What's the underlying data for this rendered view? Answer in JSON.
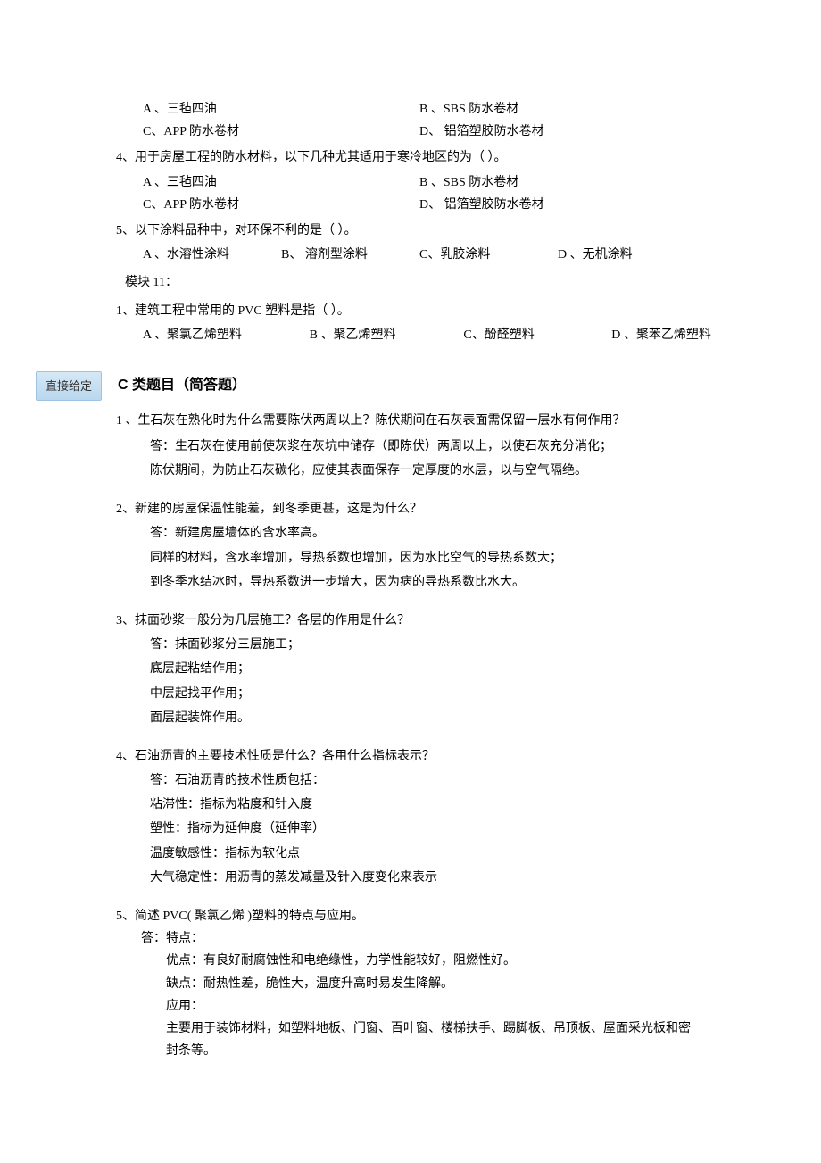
{
  "top": {
    "opts1": {
      "a": "A 、三毡四油",
      "b": "B 、SBS 防水卷材",
      "c": "C、APP 防水卷材",
      "d": "D、 铝箔塑胶防水卷材"
    },
    "q4": "4、用于房屋工程的防水材料，以下几种尤其适用于寒冷地区的为（           ）。",
    "opts4": {
      "a": "A 、三毡四油",
      "b": "B 、SBS 防水卷材",
      "c": "C、APP 防水卷材",
      "d": "D、 铝箔塑胶防水卷材"
    },
    "q5": "5、以下涂料品种中，对环保不利的是（          ）。",
    "opts5": {
      "a": "A 、水溶性涂料",
      "b": "B、 溶剂型涂料",
      "c": "C、乳胶涂料",
      "d": "D 、无机涂料"
    },
    "module": "模块  11：",
    "m11q1": "1、建筑工程中常用的    PVC 塑料是指（       ）。",
    "m11opts": {
      "a": "A 、聚氯乙烯塑料",
      "b": "B 、聚乙烯塑料",
      "c": "C、酚醛塑料",
      "d": "D 、聚苯乙烯塑料"
    }
  },
  "badge": "直接给定",
  "sectionC": "C 类题目（简答题）",
  "c1": {
    "q": "1 、生石灰在熟化时为什么需要陈伏两周以上？陈伏期间在石灰表面需保留一层水有何作用？",
    "a1": "答：生石灰在使用前使灰浆在灰坑中储存（即陈伏）两周以上，以使石灰充分消化；",
    "a2": "陈伏期间，为防止石灰碳化，应使其表面保存一定厚度的水层，以与空气隔绝。"
  },
  "c2": {
    "q": "2、新建的房屋保温性能差，到冬季更甚，这是为什么？",
    "a1": "答：新建房屋墙体的含水率高。",
    "a2": "同样的材料，含水率增加，导热系数也增加，因为水比空气的导热系数大；",
    "a3": "到冬季水结冰时，导热系数进一步增大，因为病的导热系数比水大。"
  },
  "c3": {
    "q": "3、抹面砂浆一般分为几层施工？各层的作用是什么？",
    "a1": "答：抹面砂浆分三层施工；",
    "a2": "底层起粘结作用；",
    "a3": "中层起找平作用；",
    "a4": "面层起装饰作用。"
  },
  "c4": {
    "q": "4、石油沥青的主要技术性质是什么？各用什么指标表示？",
    "a1": "答：石油沥青的技术性质包括：",
    "a2": "粘滞性：指标为粘度和针入度",
    "a3": "塑性：指标为延伸度（延伸率）",
    "a4": "温度敏感性：指标为软化点",
    "a5": "大气稳定性：用沥青的蒸发减量及针入度变化来表示"
  },
  "c5": {
    "q": "5、简述 PVC( 聚氯乙烯 )塑料的特点与应用。",
    "a0": "答：特点：",
    "a1": "优点：有良好耐腐蚀性和电绝缘性，力学性能较好，阻燃性好。",
    "a2": "缺点：耐热性差，脆性大，温度升高时易发生降解。",
    "a3": "应用：",
    "a4": "主要用于装饰材料，如塑料地板、门窗、百叶窗、楼梯扶手、踢脚板、吊顶板、屋面采光板和密封条等。"
  }
}
